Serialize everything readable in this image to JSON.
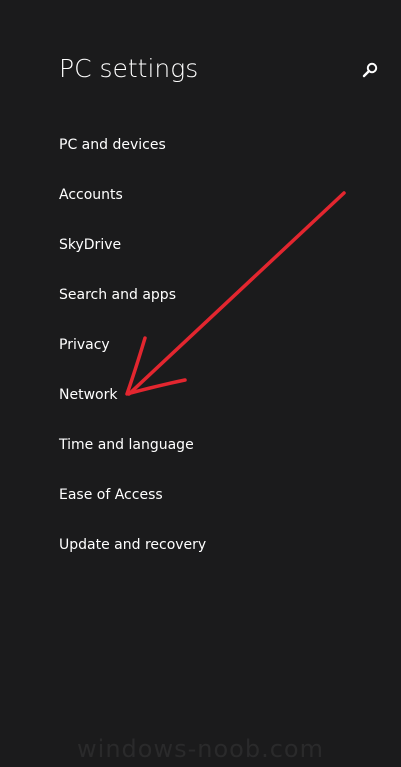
{
  "header": {
    "title": "PC settings",
    "search_icon": "search-icon"
  },
  "nav": {
    "items": [
      {
        "label": "PC and devices"
      },
      {
        "label": "Accounts"
      },
      {
        "label": "SkyDrive"
      },
      {
        "label": "Search and apps"
      },
      {
        "label": "Privacy"
      },
      {
        "label": "Network"
      },
      {
        "label": "Time and language"
      },
      {
        "label": "Ease of Access"
      },
      {
        "label": "Update and recovery"
      }
    ]
  },
  "annotation": {
    "arrow_color": "#e3262f"
  },
  "watermark": {
    "text": "windows-noob.com"
  },
  "colors": {
    "background": "#1b1b1c",
    "text": "#ffffff"
  }
}
